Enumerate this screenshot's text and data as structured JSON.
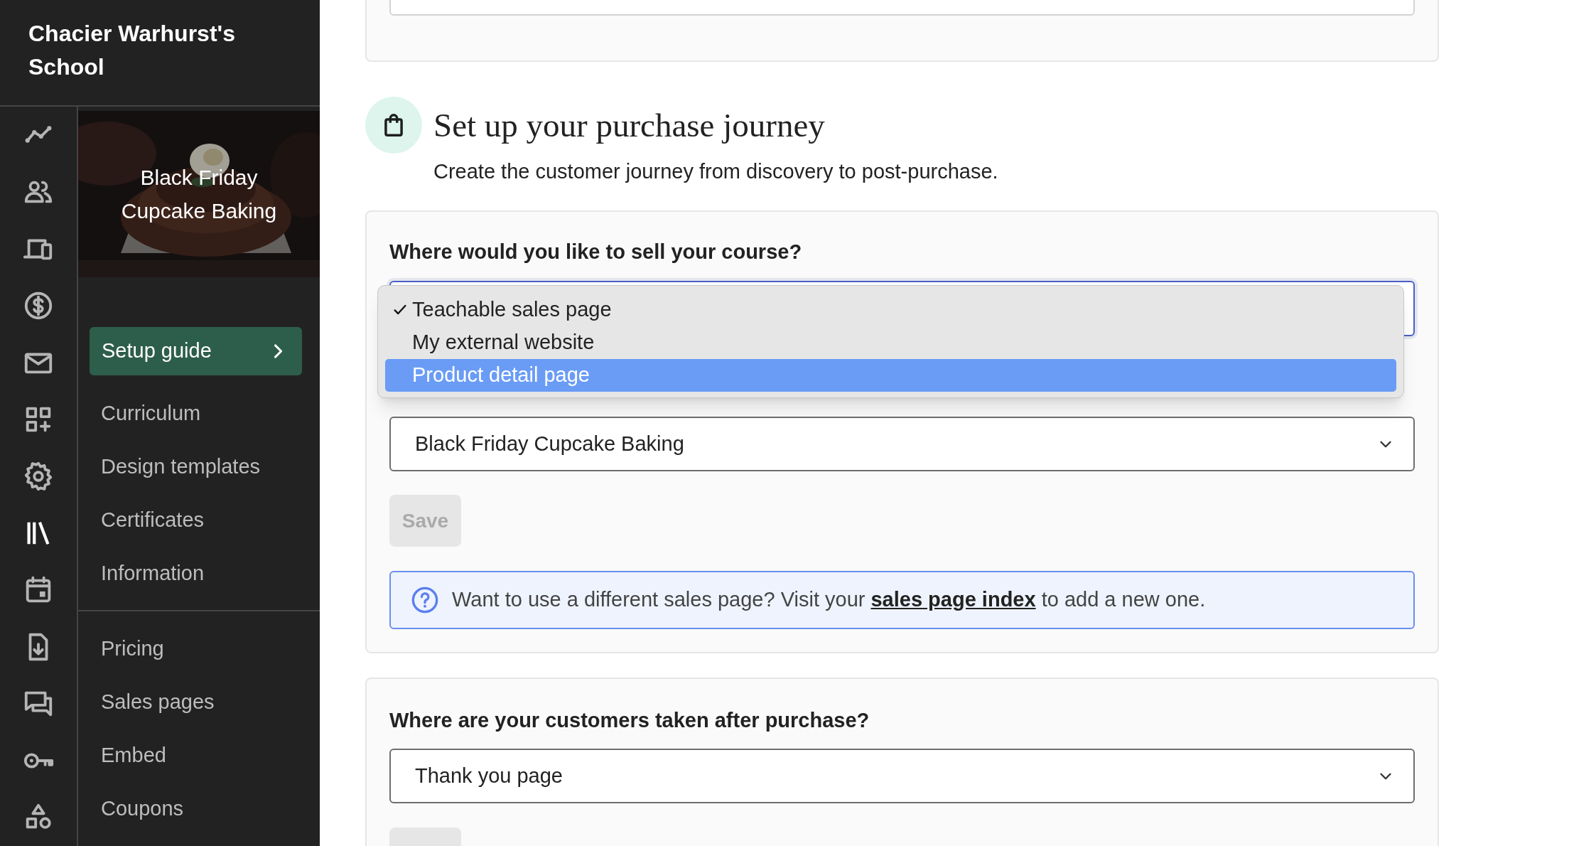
{
  "sidebar": {
    "school_name": "Chacier Warhurst's School",
    "course": {
      "title": "Black Friday Cupcake Baking"
    },
    "setup_guide": {
      "label": "Setup guide"
    },
    "nav_groups": [
      [
        {
          "label": "Curriculum"
        },
        {
          "label": "Design templates"
        },
        {
          "label": "Certificates"
        },
        {
          "label": "Information"
        }
      ],
      [
        {
          "label": "Pricing"
        },
        {
          "label": "Sales pages"
        },
        {
          "label": "Embed"
        },
        {
          "label": "Coupons"
        }
      ]
    ]
  },
  "section": {
    "title": "Set up your purchase journey",
    "subtitle": "Create the customer journey from discovery to post-purchase."
  },
  "sell_card": {
    "question": "Where would you like to sell your course?",
    "sell_select": {
      "expanded": true,
      "options": [
        {
          "label": "Teachable sales page",
          "checked": true,
          "selected": false
        },
        {
          "label": "My external website",
          "checked": false,
          "selected": false
        },
        {
          "label": "Product detail page",
          "checked": false,
          "selected": true
        }
      ]
    },
    "page_select": {
      "value": "Black Friday Cupcake Baking"
    },
    "save_button": {
      "label": "Save",
      "disabled": true
    },
    "info": {
      "before": "Want to use a different sales page? Visit your ",
      "link": "sales page index",
      "after": " to add a new one."
    }
  },
  "after_purchase_card": {
    "question": "Where are your customers taken after purchase?",
    "page_select": {
      "value": "Thank you page"
    },
    "save_button": {
      "disabled": true
    }
  }
}
